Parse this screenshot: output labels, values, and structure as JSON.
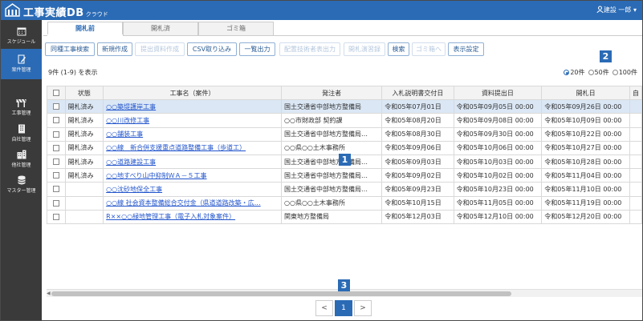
{
  "app": {
    "title": "工事実績DB",
    "subtitle": "クラウド",
    "user": "建設 一郎"
  },
  "sidebar": {
    "items": [
      {
        "label": "スケジュール",
        "icon": "calendar-icon"
      },
      {
        "label": "案件管理",
        "icon": "document-pen-icon",
        "active": true
      },
      {
        "label": "工事管理",
        "icon": "barrier-icon"
      },
      {
        "label": "自社管理",
        "icon": "building-icon"
      },
      {
        "label": "他社管理",
        "icon": "buildings-icon"
      },
      {
        "label": "マスター管理",
        "icon": "database-icon"
      }
    ]
  },
  "tabs": [
    {
      "label": "開札前",
      "active": true
    },
    {
      "label": "開札済"
    },
    {
      "label": "ゴミ箱"
    }
  ],
  "toolbar": [
    {
      "label": "同種工事検索",
      "enabled": true
    },
    {
      "label": "新規作成",
      "enabled": true
    },
    {
      "label": "提出資料作成",
      "enabled": false
    },
    {
      "label": "CSV取り込み",
      "enabled": true
    },
    {
      "label": "一覧出力",
      "enabled": true
    },
    {
      "label": "配置技術者表出力",
      "enabled": false
    },
    {
      "label": "開札演習録",
      "enabled": false
    },
    {
      "label": "検索",
      "enabled": true
    },
    {
      "label": "ゴミ箱へ",
      "enabled": false
    },
    {
      "label": "表示設定",
      "enabled": true
    }
  ],
  "list": {
    "count_text": "9件 (1-9) を表示",
    "per_page": {
      "options": [
        "20件",
        "50件",
        "100件"
      ],
      "selected": "20件"
    },
    "columns": [
      "状態",
      "工事名（案件）",
      "発注者",
      "入札説明書交付日",
      "資料提出日",
      "開札日",
      "自"
    ],
    "rows": [
      {
        "status": "開札済み",
        "name": "○○築堤護岸工事",
        "orderer": "国土交通省中部地方整備局",
        "notice": "令和05年07月01日",
        "submit": "令和05年09月05日 00:00",
        "open": "令和05年09月26日 00:00"
      },
      {
        "status": "開札済み",
        "name": "○○川改修工事",
        "orderer": "○○市財政部 契約課",
        "notice": "令和05年08月20日",
        "submit": "令和05年09月08日 00:00",
        "open": "令和05年10月09日 00:00"
      },
      {
        "status": "開札済み",
        "name": "○○舗装工事",
        "orderer": "国土交通省中部地方整備局…",
        "notice": "令和05年08月30日",
        "submit": "令和05年09月30日 00:00",
        "open": "令和05年10月22日 00:00"
      },
      {
        "status": "開札済み",
        "name": "○○線　新合併支援重点道路整備工事（歩道工）",
        "orderer": "○○県○○土木事務所",
        "notice": "令和05年09月06日",
        "submit": "令和05年10月06日 00:00",
        "open": "令和05年10月27日 00:00"
      },
      {
        "status": "開札済み",
        "name": "○○道路建設工事",
        "orderer": "国土交通省中部地方整備局…",
        "notice": "令和05年09月03日",
        "submit": "令和05年10月03日 00:00",
        "open": "令和05年10月28日 00:00"
      },
      {
        "status": "開札済み",
        "name": "○○地すべり山中抑制ＷＡ－５工事",
        "orderer": "国土交通省中部地方整備局…",
        "notice": "令和05年09月02日",
        "submit": "令和05年10月02日 00:00",
        "open": "令和05年11月04日 00:00"
      },
      {
        "status": "",
        "name": "○○沈砂地保全工事",
        "orderer": "国土交通省中部地方整備局…",
        "notice": "令和05年09月23日",
        "submit": "令和05年10月23日 00:00",
        "open": "令和05年11月10日 00:00"
      },
      {
        "status": "",
        "name": "○○線 社会資本整備総合交付金（県道道路改築・広…",
        "orderer": "○○県○○土木事務所",
        "notice": "令和05年10月15日",
        "submit": "令和05年11月05日 00:00",
        "open": "令和05年11月19日 00:00"
      },
      {
        "status": "",
        "name": "R××○○緑地管理工事（電子入札対象案件）",
        "orderer": "関東地方整備局",
        "notice": "令和05年12月03日",
        "submit": "令和05年12月10日 00:00",
        "open": "令和05年12月20日 00:00"
      }
    ]
  },
  "markers": [
    "1",
    "2",
    "3"
  ],
  "pager": {
    "prev": "<",
    "current": "1",
    "next": ">"
  },
  "colors": {
    "primary": "#2b6bb5",
    "sidebar": "#3a3a3a",
    "link": "#2255cc"
  }
}
